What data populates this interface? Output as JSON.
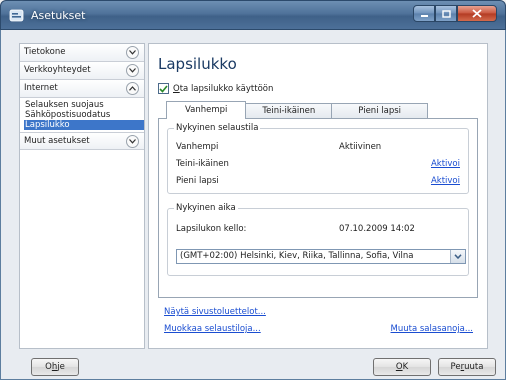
{
  "window": {
    "title": "Asetukset",
    "controls": {
      "minimize": "minimize-icon",
      "maximize": "maximize-icon",
      "close": "close-icon"
    }
  },
  "sidebar": {
    "categories": [
      {
        "label": "Tietokone",
        "expanded": false
      },
      {
        "label": "Verkkoyhteydet",
        "expanded": false
      },
      {
        "label": "Internet",
        "expanded": true,
        "items": [
          {
            "label": "Selauksen suojaus"
          },
          {
            "label": "Sähköpostisuodatus"
          },
          {
            "label": "Lapsilukko",
            "selected": true
          }
        ]
      },
      {
        "label": "Muut asetukset",
        "expanded": false
      }
    ]
  },
  "main": {
    "heading": "Lapsilukko",
    "enable": {
      "label_first": "O",
      "label_rest": "ta lapsilukko käyttöön",
      "checked": true
    },
    "tabs": [
      {
        "label": "Vanhempi",
        "active": true
      },
      {
        "label": "Teini-ikäinen",
        "active": false
      },
      {
        "label": "Pieni lapsi",
        "active": false
      }
    ],
    "current_profile": {
      "legend": "Nykyinen selaustila",
      "rows": [
        {
          "label": "Vanhempi",
          "status": "Aktiivinen",
          "link": ""
        },
        {
          "label": "Teini-ikäinen",
          "status": "",
          "link": "Aktivoi"
        },
        {
          "label": "Pieni lapsi",
          "status": "",
          "link": "Aktivoi"
        }
      ]
    },
    "current_time": {
      "legend": "Nykyinen aika",
      "clock_label": "Lapsilukon kello:",
      "clock_value": "07.10.2009 14:02",
      "timezone": "(GMT+02:00) Helsinki, Kiev, Riika, Tallinna, Sofia, Vilna"
    },
    "links": {
      "show_sites": "Näytä sivustoluettelot...",
      "edit_browsing": "Muokkaa selaustiloja...",
      "change_password": "Muuta salasanoja..."
    }
  },
  "footer": {
    "help_first": "O",
    "help_u": "h",
    "help_rest": "je",
    "ok_first": "O",
    "ok_rest": "K",
    "cancel_first": "Pe",
    "cancel_u": "r",
    "cancel_rest": "uuta"
  },
  "colors": {
    "titlebar": "#4f729a",
    "link": "#1a4dd1",
    "selection": "#3d76c9",
    "heading": "#1a3a63"
  }
}
